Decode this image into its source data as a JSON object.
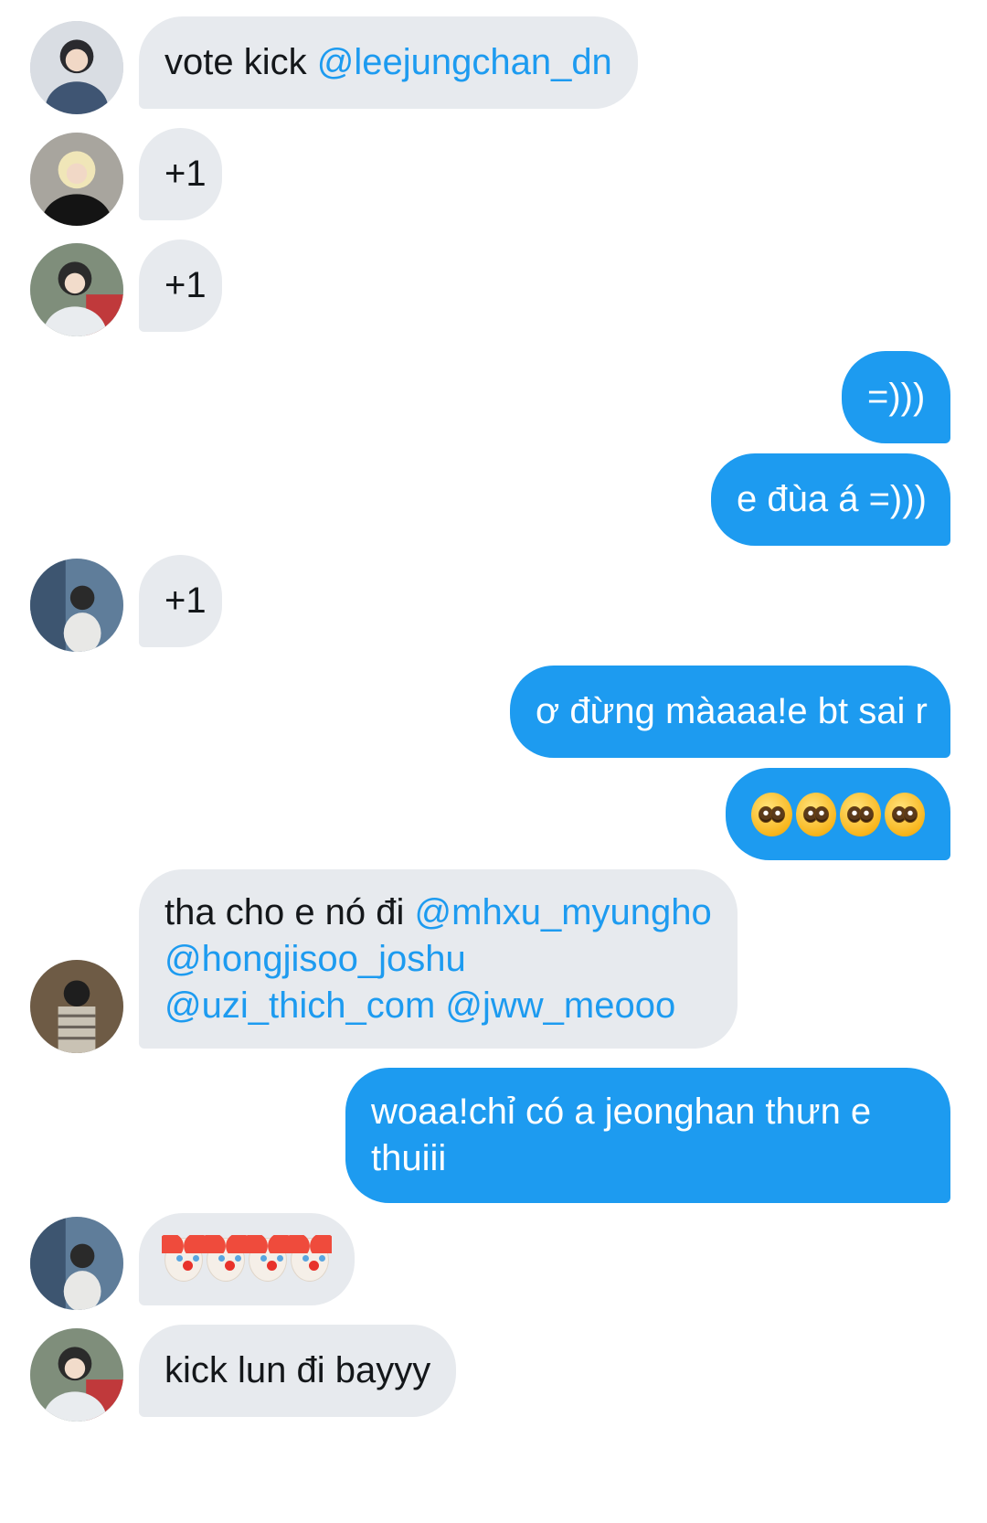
{
  "messages": [
    {
      "id": 1,
      "direction": "incoming",
      "parts": [
        {
          "text": "vote kick "
        },
        {
          "mention": "@leejungchan_dn"
        }
      ]
    },
    {
      "id": 2,
      "direction": "incoming",
      "text": "+1"
    },
    {
      "id": 3,
      "direction": "incoming",
      "text": "+1"
    },
    {
      "id": 4,
      "direction": "outgoing",
      "text": "=)))"
    },
    {
      "id": 5,
      "direction": "outgoing",
      "text": "e đùa á =)))"
    },
    {
      "id": 6,
      "direction": "incoming",
      "text": "+1"
    },
    {
      "id": 7,
      "direction": "outgoing",
      "text": "ơ đừng màaaa!e bt sai r"
    },
    {
      "id": 8,
      "direction": "outgoing",
      "emoji": [
        "pleading-face",
        "pleading-face",
        "pleading-face",
        "pleading-face"
      ]
    },
    {
      "id": 9,
      "direction": "incoming",
      "lines": [
        {
          "text": "tha cho e nó đi ",
          "mention": "@mhxu_myungho"
        },
        {
          "mention": "@hongjisoo_joshu"
        },
        {
          "mention": "@uzi_thich_com @jww_meooo"
        }
      ]
    },
    {
      "id": 10,
      "direction": "outgoing",
      "lines": [
        "woaa!chỉ có a jeonghan thưn e",
        "thuiii"
      ]
    },
    {
      "id": 11,
      "direction": "incoming",
      "emoji": [
        "clown-face",
        "clown-face",
        "clown-face",
        "clown-face"
      ]
    },
    {
      "id": 12,
      "direction": "incoming",
      "text": "kick lun đi bayyy"
    }
  ],
  "colors": {
    "incoming_bubble": "#e7eaee",
    "outgoing_bubble": "#1d9bf0",
    "mention": "#1d9bf0",
    "text": "#14171a"
  },
  "icons": {
    "avatar": "user-avatar-photo",
    "pleading": "pleading-face-emoji",
    "clown": "clown-face-emoji"
  }
}
